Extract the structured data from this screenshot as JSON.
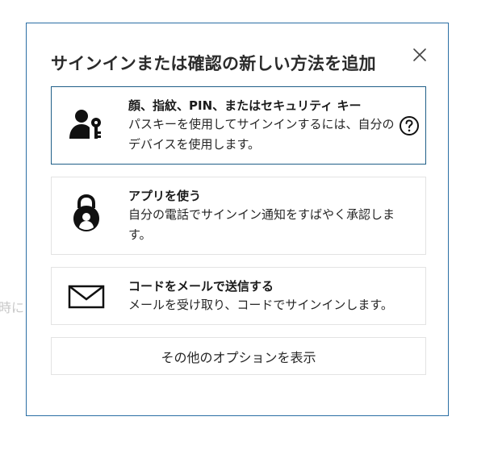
{
  "background": {
    "partial_text": "時に"
  },
  "dialog": {
    "title": "サインインまたは確認の新しい方法を追加",
    "close_icon": "close-icon",
    "options": [
      {
        "title": "顔、指紋、PIN、またはセキュリティ キー",
        "description": "パスキーを使用してサインインするには、自分のデバイスを使用します。",
        "icon": "person-key-icon",
        "help_icon": "help-circle-icon",
        "selected": true
      },
      {
        "title": "アプリを使う",
        "description": "自分の電話でサインイン通知をすばやく承認します。",
        "icon": "authenticator-lock-icon",
        "selected": false
      },
      {
        "title": "コードをメールで送信する",
        "description": "メールを受け取り、コードでサインインします。",
        "icon": "envelope-icon",
        "selected": false
      }
    ],
    "more_options_label": "その他のオプションを表示"
  },
  "colors": {
    "dialog_border": "#2a6ea4",
    "selected_border": "#1f5f88",
    "option_border": "#e3e3e3",
    "title_text": "#2b2b2b"
  }
}
